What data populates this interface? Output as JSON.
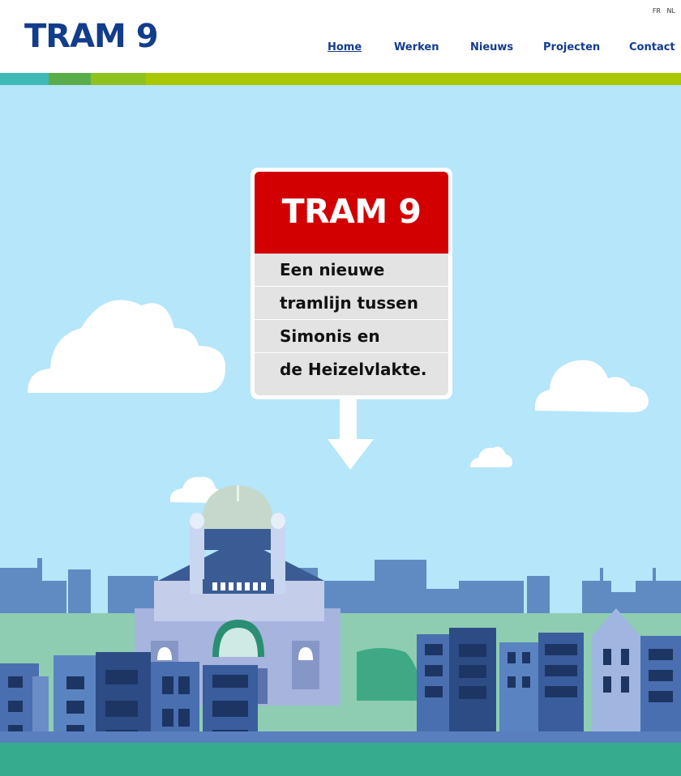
{
  "header": {
    "logo": "TRAM 9",
    "languages": [
      "FR",
      "NL"
    ],
    "nav": [
      {
        "label": "Home",
        "active": true
      },
      {
        "label": "Werken",
        "active": false
      },
      {
        "label": "Nieuws",
        "active": false
      },
      {
        "label": "Projecten",
        "active": false
      },
      {
        "label": "Contact",
        "active": false
      }
    ]
  },
  "hero": {
    "sign_title": "TRAM 9",
    "sign_lines": [
      "Een nieuwe",
      "tramlijn tussen",
      "Simonis en",
      "de Heizelvlakte."
    ]
  },
  "colors": {
    "brand_blue": "#123c8c",
    "sign_red": "#d20000",
    "sky": "#b5e6fa",
    "stripe": [
      "#3fb9b5",
      "#5aae4a",
      "#8fc21f",
      "#aac800"
    ]
  }
}
